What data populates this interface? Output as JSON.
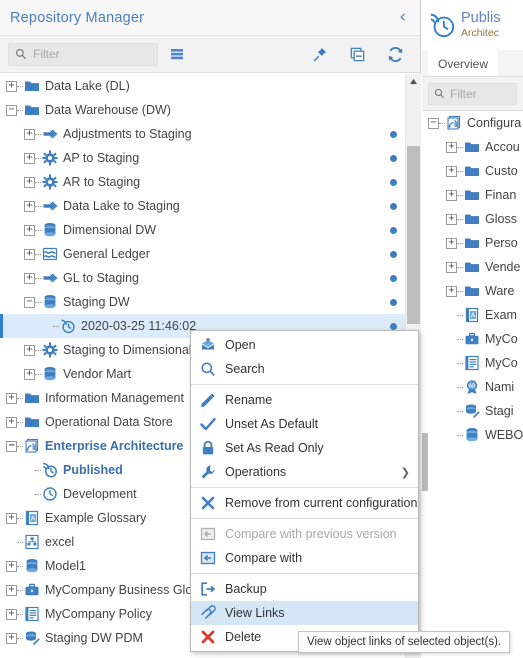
{
  "left_panel": {
    "title": "Repository Manager",
    "collapse_icon": "chevron-left-icon",
    "toolbar": {
      "filter_placeholder": "Filter",
      "search_icon": "search-icon",
      "list_icon": "list-view-icon",
      "pin_icon": "pin-icon",
      "collapse_all_icon": "collapse-all-icon",
      "refresh_icon": "refresh-icon"
    },
    "tree": [
      {
        "label": "Data Lake (DL)",
        "icon": "folder-icon",
        "indent": 1,
        "twisty": "+",
        "dot": false,
        "bold": false,
        "selected": false
      },
      {
        "label": "Data Warehouse (DW)",
        "icon": "folder-icon",
        "indent": 1,
        "twisty": "-",
        "dot": false,
        "bold": false,
        "selected": false
      },
      {
        "label": "Adjustments to Staging",
        "icon": "mapping-icon",
        "indent": 2,
        "twisty": "+",
        "dot": true,
        "bold": false,
        "selected": false
      },
      {
        "label": "AP to Staging",
        "icon": "gear-icon",
        "indent": 2,
        "twisty": "+",
        "dot": true,
        "bold": false,
        "selected": false
      },
      {
        "label": "AR to Staging",
        "icon": "gear-icon",
        "indent": 2,
        "twisty": "+",
        "dot": true,
        "bold": false,
        "selected": false
      },
      {
        "label": "Data Lake to Staging",
        "icon": "mapping-icon",
        "indent": 2,
        "twisty": "+",
        "dot": true,
        "bold": false,
        "selected": false
      },
      {
        "label": "Dimensional DW",
        "icon": "database-icon",
        "indent": 2,
        "twisty": "+",
        "dot": true,
        "bold": false,
        "selected": false
      },
      {
        "label": "General Ledger",
        "icon": "model-icon",
        "indent": 2,
        "twisty": "+",
        "dot": true,
        "bold": false,
        "selected": false
      },
      {
        "label": "GL to Staging",
        "icon": "mapping-icon",
        "indent": 2,
        "twisty": "+",
        "dot": true,
        "bold": false,
        "selected": false
      },
      {
        "label": "Staging DW",
        "icon": "database-icon",
        "indent": 2,
        "twisty": "-",
        "dot": true,
        "bold": false,
        "selected": false
      },
      {
        "label": "2020-03-25 11:46:02",
        "icon": "version-icon",
        "indent": 3,
        "twisty": "none",
        "dot": true,
        "bold": false,
        "selected": true
      },
      {
        "label": "Staging to Dimensional DW",
        "icon": "gear-icon",
        "indent": 2,
        "twisty": "+",
        "dot": false,
        "bold": false,
        "selected": false
      },
      {
        "label": "Vendor Mart",
        "icon": "database-icon",
        "indent": 2,
        "twisty": "+",
        "dot": false,
        "bold": false,
        "selected": false
      },
      {
        "label": "Information Management",
        "icon": "folder-icon",
        "indent": 1,
        "twisty": "+",
        "dot": false,
        "bold": false,
        "selected": false
      },
      {
        "label": "Operational Data Store",
        "icon": "folder-icon",
        "indent": 1,
        "twisty": "+",
        "dot": false,
        "bold": false,
        "selected": false
      },
      {
        "label": "Enterprise Architecture",
        "icon": "stack-icon",
        "indent": 1,
        "twisty": "-",
        "dot": false,
        "bold": true,
        "selected": false
      },
      {
        "label": "Published",
        "icon": "published-icon",
        "indent": 2,
        "twisty": "none",
        "dot": false,
        "bold": true,
        "selected": false
      },
      {
        "label": "Development",
        "icon": "clock-icon",
        "indent": 2,
        "twisty": "none",
        "dot": false,
        "bold": false,
        "selected": false
      },
      {
        "label": "Example Glossary",
        "icon": "glossary-icon",
        "indent": 1,
        "twisty": "+",
        "dot": false,
        "bold": false,
        "selected": false
      },
      {
        "label": "excel",
        "icon": "structure-icon",
        "indent": 1,
        "twisty": "none",
        "dot": false,
        "bold": false,
        "selected": false
      },
      {
        "label": "Model1",
        "icon": "database-icon",
        "indent": 1,
        "twisty": "+",
        "dot": false,
        "bold": false,
        "selected": false
      },
      {
        "label": "MyCompany Business Glossary",
        "icon": "briefcase-icon",
        "indent": 1,
        "twisty": "+",
        "dot": false,
        "bold": false,
        "selected": false
      },
      {
        "label": "MyCompany Policy",
        "icon": "policy-icon",
        "indent": 1,
        "twisty": "+",
        "dot": false,
        "bold": false,
        "selected": false
      },
      {
        "label": "Staging DW PDM",
        "icon": "pdm-icon",
        "indent": 1,
        "twisty": "+",
        "dot": false,
        "bold": false,
        "selected": false
      }
    ]
  },
  "context_menu": {
    "items": [
      {
        "label": "Open",
        "icon": "open-icon",
        "state": "normal",
        "submenu": false,
        "separator_after": false
      },
      {
        "label": "Search",
        "icon": "search-icon",
        "state": "normal",
        "submenu": false,
        "separator_after": true
      },
      {
        "label": "Rename",
        "icon": "pencil-icon",
        "state": "normal",
        "submenu": false,
        "separator_after": false
      },
      {
        "label": "Unset As Default",
        "icon": "check-icon",
        "state": "normal",
        "submenu": false,
        "separator_after": false
      },
      {
        "label": "Set As Read Only",
        "icon": "lock-icon",
        "state": "normal",
        "submenu": false,
        "separator_after": false
      },
      {
        "label": "Operations",
        "icon": "wrench-icon",
        "state": "normal",
        "submenu": true,
        "separator_after": true
      },
      {
        "label": "Remove from current configuration",
        "icon": "x-blue-icon",
        "state": "normal",
        "submenu": false,
        "separator_after": true
      },
      {
        "label": "Compare with previous version",
        "icon": "compare-icon",
        "state": "disabled",
        "submenu": false,
        "separator_after": false
      },
      {
        "label": "Compare with",
        "icon": "compare-icon",
        "state": "normal",
        "submenu": false,
        "separator_after": true
      },
      {
        "label": "Backup",
        "icon": "backup-icon",
        "state": "normal",
        "submenu": false,
        "separator_after": false
      },
      {
        "label": "View Links",
        "icon": "links-icon",
        "state": "highlight",
        "submenu": false,
        "separator_after": false
      },
      {
        "label": "Delete",
        "icon": "x-red-icon",
        "state": "normal",
        "submenu": false,
        "separator_after": false
      }
    ],
    "submenu_arrow": "chevron-right-icon"
  },
  "tooltip": {
    "text": "View object links of selected object(s)."
  },
  "right_panel": {
    "title": "Publis",
    "subtitle": "Architec",
    "header_icon": "published-icon",
    "tab": "Overview",
    "filter_placeholder": "Filter",
    "search_icon": "search-icon",
    "tree": [
      {
        "label": "Configura",
        "icon": "stack-icon",
        "indent": 1,
        "twisty": "-"
      },
      {
        "label": "Accou",
        "icon": "folder-icon",
        "indent": 2,
        "twisty": "+"
      },
      {
        "label": "Custo",
        "icon": "folder-icon",
        "indent": 2,
        "twisty": "+"
      },
      {
        "label": "Finan",
        "icon": "folder-icon",
        "indent": 2,
        "twisty": "+"
      },
      {
        "label": "Gloss",
        "icon": "folder-icon",
        "indent": 2,
        "twisty": "+"
      },
      {
        "label": "Perso",
        "icon": "folder-icon",
        "indent": 2,
        "twisty": "+"
      },
      {
        "label": "Vende",
        "icon": "folder-icon",
        "indent": 2,
        "twisty": "+"
      },
      {
        "label": "Ware",
        "icon": "folder-icon",
        "indent": 2,
        "twisty": "+"
      },
      {
        "label": "Exam",
        "icon": "glossary-icon",
        "indent": 2,
        "twisty": "none"
      },
      {
        "label": "MyCo",
        "icon": "briefcase-icon",
        "indent": 2,
        "twisty": "none"
      },
      {
        "label": "MyCo",
        "icon": "policy-icon",
        "indent": 2,
        "twisty": "none"
      },
      {
        "label": "Nami",
        "icon": "naming-icon",
        "indent": 2,
        "twisty": "none"
      },
      {
        "label": "Stagi",
        "icon": "pdm-icon",
        "indent": 2,
        "twisty": "none"
      },
      {
        "label": "WEBO",
        "icon": "database-icon",
        "indent": 2,
        "twisty": "none"
      }
    ]
  },
  "colors": {
    "accent": "#3f7fc1",
    "selection": "#dcebf9",
    "menu_highlight": "#d5e6f7",
    "title": "#4a7ebb"
  }
}
